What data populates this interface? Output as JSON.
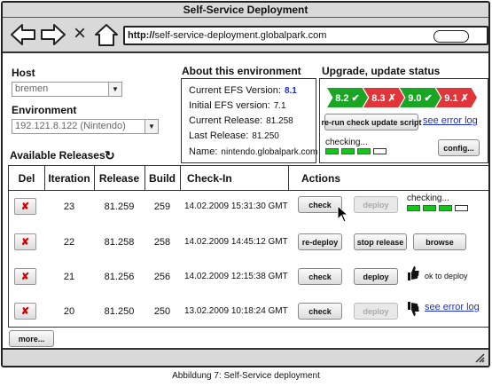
{
  "window": {
    "title": "Self-Service Deployment"
  },
  "browser": {
    "url_prefix": "http://",
    "url_rest": "self-service-deployment.globalpark.com",
    "close_glyph": "×"
  },
  "host": {
    "label": "Host",
    "value": "bremen"
  },
  "environment": {
    "label": "Environment",
    "value": "192.121.8.122 (Nintendo)"
  },
  "about": {
    "title": "About this environment",
    "rows": [
      {
        "key": "Current EFS Version:",
        "value": "8.1"
      },
      {
        "key": "Initial EFS version:",
        "value": "7.1"
      },
      {
        "key": "Current Release:",
        "value": "81.258"
      },
      {
        "key": "Last Release:",
        "value": "81.250"
      },
      {
        "key": "Name:",
        "value": "nintendo.globalpark.com"
      }
    ]
  },
  "status": {
    "title": "Upgrade, update status",
    "chevrons": [
      {
        "label": "8.2 ✔",
        "color": "#1aa624"
      },
      {
        "label": "8.3 ✗",
        "color": "#e0353b"
      },
      {
        "label": "9.0 ✔",
        "color": "#1aa624"
      },
      {
        "label": "9.1 ✗",
        "color": "#e0353b"
      }
    ],
    "rerun_label": "re-run check update script",
    "error_link": "see error log",
    "checking_label": "checking...",
    "config_label": "config...",
    "progress_on": 3,
    "progress_total": 4
  },
  "releases": {
    "title": "Available Releases",
    "refresh_glyph": "↻",
    "columns": [
      "Del",
      "Iteration",
      "Release",
      "Build",
      "Check-In",
      "Actions"
    ],
    "rows": [
      {
        "del": "✘",
        "iteration": "23",
        "release": "81.259",
        "build": "259",
        "checkin": "14.02.2009 15:31:30 GMT",
        "action1": "check",
        "action2": "deploy",
        "action2_disabled": true,
        "note": "checking..."
      },
      {
        "del": "✘",
        "iteration": "22",
        "release": "81.258",
        "build": "258",
        "checkin": "14.02.2009 14:45:12 GMT",
        "action1": "re-deploy",
        "action2": "stop release",
        "action3": "browse"
      },
      {
        "del": "✘",
        "iteration": "21",
        "release": "81.256",
        "build": "256",
        "checkin": "14.02.2009 12:15:38 GMT",
        "action1": "check",
        "action2": "deploy",
        "note": "ok to deploy"
      },
      {
        "del": "✘",
        "iteration": "20",
        "release": "81.250",
        "build": "250",
        "checkin": "13.02.2009 10:18:24 GMT",
        "action1": "check",
        "action2": "deploy",
        "action2_disabled": true,
        "note": "see error log"
      }
    ],
    "more_label": "more..."
  },
  "caption": "Abbildung 7: Self-Service deployment"
}
